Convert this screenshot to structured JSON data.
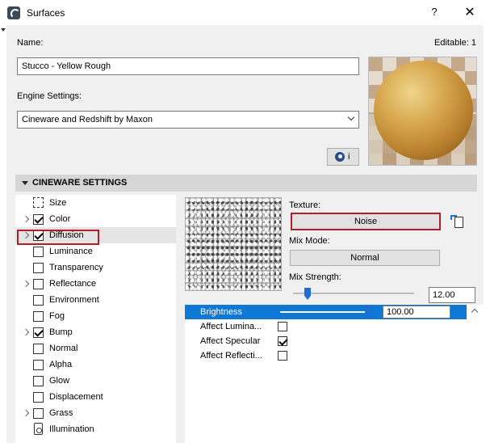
{
  "window": {
    "title": "Surfaces",
    "help_label": "?",
    "close_label": "✕"
  },
  "form": {
    "name_label": "Name:",
    "editable_label": "Editable: 1",
    "name_value": "Stucco - Yellow Rough",
    "engine_label": "Engine Settings:",
    "engine_value": "Cineware and Redshift by Maxon",
    "info_button_label": "i"
  },
  "section": {
    "title": "CINEWARE SETTINGS"
  },
  "channels": [
    {
      "label": "Size",
      "icon": "size-icon",
      "expandable": false,
      "checkbox": false,
      "checked": false
    },
    {
      "label": "Color",
      "expandable": true,
      "checkbox": true,
      "checked": true
    },
    {
      "label": "Diffusion",
      "expandable": true,
      "checkbox": true,
      "checked": true,
      "selected": true
    },
    {
      "label": "Luminance",
      "expandable": false,
      "checkbox": true,
      "checked": false
    },
    {
      "label": "Transparency",
      "expandable": false,
      "checkbox": true,
      "checked": false
    },
    {
      "label": "Reflectance",
      "expandable": true,
      "checkbox": true,
      "checked": false
    },
    {
      "label": "Environment",
      "expandable": false,
      "checkbox": true,
      "checked": false
    },
    {
      "label": "Fog",
      "expandable": false,
      "checkbox": true,
      "checked": false
    },
    {
      "label": "Bump",
      "expandable": true,
      "checkbox": true,
      "checked": true
    },
    {
      "label": "Normal",
      "expandable": false,
      "checkbox": true,
      "checked": false
    },
    {
      "label": "Alpha",
      "expandable": false,
      "checkbox": true,
      "checked": false
    },
    {
      "label": "Glow",
      "expandable": false,
      "checkbox": true,
      "checked": false
    },
    {
      "label": "Displacement",
      "expandable": false,
      "checkbox": true,
      "checked": false
    },
    {
      "label": "Grass",
      "expandable": true,
      "checkbox": true,
      "checked": false
    },
    {
      "label": "Illumination",
      "icon": "illumination-icon",
      "expandable": false,
      "checkbox": false,
      "checked": false
    }
  ],
  "texture": {
    "label": "Texture:",
    "value": "Noise",
    "mix_mode_label": "Mix Mode:",
    "mix_mode_value": "Normal",
    "mix_strength_label": "Mix Strength:",
    "mix_strength_value": "12.00",
    "mix_strength_percent": 12
  },
  "params": [
    {
      "label": "Brightness",
      "type": "slider",
      "value": "100.00",
      "slider_percent": 100,
      "selected": true
    },
    {
      "label": "Affect Lumina...",
      "type": "checkbox",
      "checked": false
    },
    {
      "label": "Affect Specular",
      "type": "checkbox",
      "checked": true
    },
    {
      "label": "Affect Reflecti...",
      "type": "checkbox",
      "checked": false
    }
  ],
  "colors": {
    "accent": "#0f77d4",
    "highlight_box": "#b0202a"
  }
}
